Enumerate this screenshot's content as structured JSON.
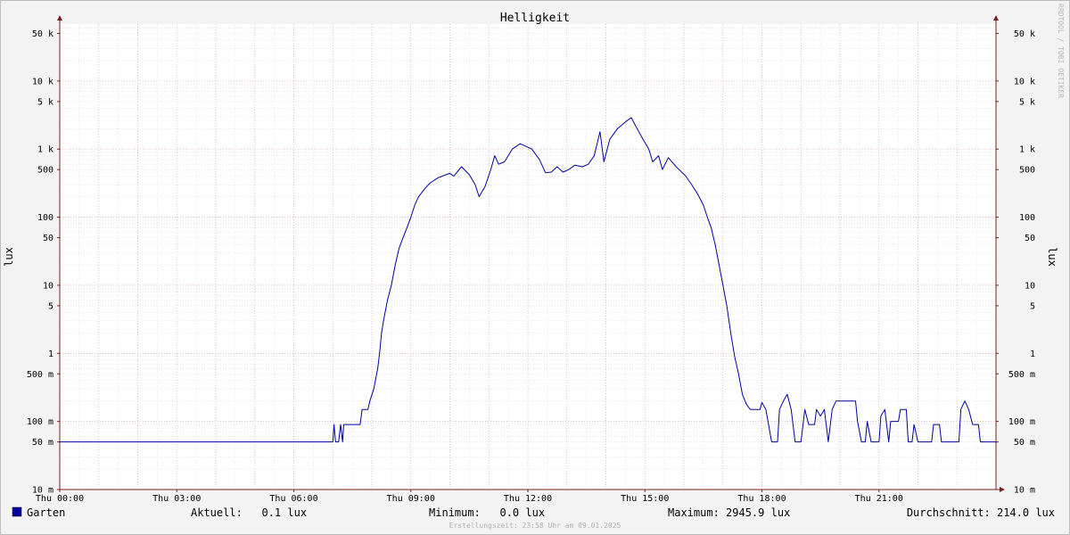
{
  "chart_data": {
    "type": "line",
    "title": "Helligkeit",
    "ylabel": "lux",
    "yscale": "log",
    "ylim": [
      0.01,
      60000
    ],
    "xlim_hours": [
      0,
      24
    ],
    "y_ticks": [
      {
        "value": 50000,
        "label": "50 k"
      },
      {
        "value": 10000,
        "label": "10 k"
      },
      {
        "value": 5000,
        "label": "5 k"
      },
      {
        "value": 1000,
        "label": "1 k"
      },
      {
        "value": 500,
        "label": "500"
      },
      {
        "value": 100,
        "label": "100"
      },
      {
        "value": 50,
        "label": "50"
      },
      {
        "value": 10,
        "label": "10"
      },
      {
        "value": 5,
        "label": "5"
      },
      {
        "value": 1,
        "label": "1"
      },
      {
        "value": 0.5,
        "label": "500 m"
      },
      {
        "value": 0.1,
        "label": "100 m"
      },
      {
        "value": 0.05,
        "label": "50 m"
      },
      {
        "value": 0.01,
        "label": "10 m"
      }
    ],
    "x_ticks": [
      {
        "hour": 0,
        "label": "Thu 00:00"
      },
      {
        "hour": 3,
        "label": "Thu 03:00"
      },
      {
        "hour": 6,
        "label": "Thu 06:00"
      },
      {
        "hour": 9,
        "label": "Thu 09:00"
      },
      {
        "hour": 12,
        "label": "Thu 12:00"
      },
      {
        "hour": 15,
        "label": "Thu 15:00"
      },
      {
        "hour": 18,
        "label": "Thu 18:00"
      },
      {
        "hour": 21,
        "label": "Thu 21:00"
      }
    ],
    "grid": true,
    "series": [
      {
        "name": "Garten",
        "color": "#0000a0",
        "points": [
          [
            0,
            0.05
          ],
          [
            7.0,
            0.05
          ],
          [
            7.03,
            0.09
          ],
          [
            7.07,
            0.05
          ],
          [
            7.15,
            0.05
          ],
          [
            7.2,
            0.09
          ],
          [
            7.25,
            0.05
          ],
          [
            7.28,
            0.09
          ],
          [
            7.7,
            0.09
          ],
          [
            7.75,
            0.15
          ],
          [
            7.9,
            0.15
          ],
          [
            7.95,
            0.2
          ],
          [
            8.05,
            0.3
          ],
          [
            8.15,
            0.6
          ],
          [
            8.2,
            1
          ],
          [
            8.25,
            2
          ],
          [
            8.3,
            3
          ],
          [
            8.4,
            6
          ],
          [
            8.5,
            10
          ],
          [
            8.6,
            20
          ],
          [
            8.7,
            35
          ],
          [
            8.8,
            50
          ],
          [
            8.9,
            70
          ],
          [
            9.0,
            100
          ],
          [
            9.1,
            150
          ],
          [
            9.2,
            200
          ],
          [
            9.35,
            260
          ],
          [
            9.5,
            320
          ],
          [
            9.7,
            380
          ],
          [
            9.9,
            420
          ],
          [
            10.0,
            440
          ],
          [
            10.1,
            400
          ],
          [
            10.3,
            550
          ],
          [
            10.5,
            420
          ],
          [
            10.65,
            300
          ],
          [
            10.75,
            200
          ],
          [
            10.9,
            280
          ],
          [
            11.05,
            500
          ],
          [
            11.15,
            800
          ],
          [
            11.25,
            600
          ],
          [
            11.4,
            650
          ],
          [
            11.6,
            1000
          ],
          [
            11.8,
            1200
          ],
          [
            11.95,
            1100
          ],
          [
            12.1,
            1000
          ],
          [
            12.3,
            700
          ],
          [
            12.45,
            450
          ],
          [
            12.6,
            460
          ],
          [
            12.75,
            550
          ],
          [
            12.9,
            460
          ],
          [
            13.05,
            500
          ],
          [
            13.2,
            580
          ],
          [
            13.4,
            550
          ],
          [
            13.55,
            600
          ],
          [
            13.7,
            800
          ],
          [
            13.85,
            1800
          ],
          [
            13.95,
            650
          ],
          [
            14.1,
            1400
          ],
          [
            14.3,
            2000
          ],
          [
            14.5,
            2500
          ],
          [
            14.65,
            2900
          ],
          [
            14.8,
            2000
          ],
          [
            14.95,
            1400
          ],
          [
            15.1,
            1000
          ],
          [
            15.2,
            650
          ],
          [
            15.35,
            800
          ],
          [
            15.45,
            500
          ],
          [
            15.6,
            750
          ],
          [
            15.8,
            550
          ],
          [
            16.05,
            400
          ],
          [
            16.2,
            300
          ],
          [
            16.35,
            220
          ],
          [
            16.5,
            150
          ],
          [
            16.6,
            100
          ],
          [
            16.7,
            70
          ],
          [
            16.8,
            40
          ],
          [
            16.9,
            20
          ],
          [
            17.0,
            10
          ],
          [
            17.1,
            5
          ],
          [
            17.2,
            2
          ],
          [
            17.3,
            0.9
          ],
          [
            17.4,
            0.5
          ],
          [
            17.5,
            0.25
          ],
          [
            17.6,
            0.18
          ],
          [
            17.7,
            0.15
          ],
          [
            17.95,
            0.15
          ],
          [
            18.0,
            0.19
          ],
          [
            18.1,
            0.15
          ],
          [
            18.25,
            0.05
          ],
          [
            18.4,
            0.05
          ],
          [
            18.45,
            0.15
          ],
          [
            18.55,
            0.2
          ],
          [
            18.65,
            0.25
          ],
          [
            18.75,
            0.15
          ],
          [
            18.85,
            0.05
          ],
          [
            19.0,
            0.05
          ],
          [
            19.1,
            0.15
          ],
          [
            19.2,
            0.09
          ],
          [
            19.35,
            0.09
          ],
          [
            19.4,
            0.15
          ],
          [
            19.5,
            0.12
          ],
          [
            19.6,
            0.15
          ],
          [
            19.7,
            0.05
          ],
          [
            19.8,
            0.15
          ],
          [
            19.9,
            0.2
          ],
          [
            20.4,
            0.2
          ],
          [
            20.45,
            0.1
          ],
          [
            20.55,
            0.05
          ],
          [
            20.65,
            0.05
          ],
          [
            20.7,
            0.1
          ],
          [
            20.8,
            0.05
          ],
          [
            21.0,
            0.05
          ],
          [
            21.05,
            0.12
          ],
          [
            21.15,
            0.15
          ],
          [
            21.25,
            0.05
          ],
          [
            21.3,
            0.1
          ],
          [
            21.5,
            0.1
          ],
          [
            21.55,
            0.15
          ],
          [
            21.7,
            0.15
          ],
          [
            21.75,
            0.05
          ],
          [
            21.85,
            0.05
          ],
          [
            21.9,
            0.09
          ],
          [
            22.0,
            0.05
          ],
          [
            22.35,
            0.05
          ],
          [
            22.4,
            0.09
          ],
          [
            22.55,
            0.09
          ],
          [
            22.6,
            0.05
          ],
          [
            23.05,
            0.05
          ],
          [
            23.1,
            0.15
          ],
          [
            23.2,
            0.2
          ],
          [
            23.3,
            0.15
          ],
          [
            23.4,
            0.09
          ],
          [
            23.55,
            0.09
          ],
          [
            23.6,
            0.05
          ],
          [
            24.0,
            0.05
          ]
        ]
      }
    ]
  },
  "legend": {
    "series_name": "Garten",
    "swatch_color": "#0000a0",
    "current": "Aktuell:   0.1 lux",
    "minimum": "Minimum:   0.0 lux",
    "maximum": "Maximum: 2945.9 lux",
    "average": "Durchschnitt: 214.0 lux"
  },
  "footer": "Erstellungszeit: 23:58 Uhr am 09.01.2025",
  "watermark": "RRDTOOL / TOBI OETIKER",
  "colors": {
    "line": "#0000a0",
    "grid_major": "#e6a0a0",
    "grid_minor": "#cfcfcf",
    "axis": "#7a2020",
    "background": "#f3f3f3",
    "plot_bg": "#ffffff"
  }
}
